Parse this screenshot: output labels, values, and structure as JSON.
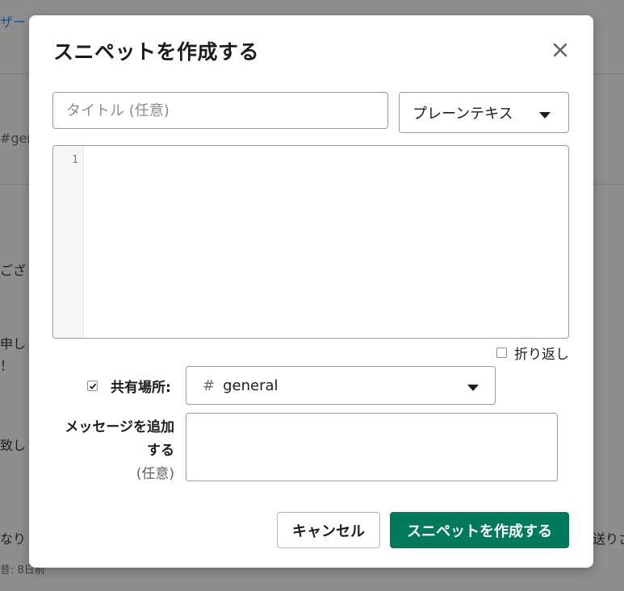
{
  "background": {
    "fragments": [
      {
        "text": "ザー",
        "style": "link"
      },
      {
        "text": "#ger",
        "style": "muted"
      },
      {
        "text": "ござ",
        "style": ""
      },
      {
        "text": "申し",
        "style": ""
      },
      {
        "text": "！",
        "style": ""
      },
      {
        "text": "致し",
        "style": ""
      },
      {
        "text": "なり",
        "style": ""
      },
      {
        "text": "送りさ",
        "style": ""
      },
      {
        "text": "昔: 8日前",
        "style": "small"
      }
    ]
  },
  "modal": {
    "title": "スニペットを作成する",
    "close_icon": "close-icon",
    "title_input": {
      "placeholder": "タイトル (任意)",
      "value": ""
    },
    "type_select": {
      "selected": "プレーンテキス"
    },
    "editor": {
      "line_numbers": [
        "1"
      ],
      "content": ""
    },
    "wrap": {
      "label": "折り返し",
      "checked": false
    },
    "share": {
      "label": "共有場所:",
      "checked": true,
      "channel_hash": "#",
      "channel": "general"
    },
    "message": {
      "label_line1": "メッセージを追加",
      "label_line2": "する",
      "label_optional": "(任意)",
      "value": ""
    },
    "buttons": {
      "cancel": "キャンセル",
      "create": "スニペットを作成する"
    },
    "colors": {
      "primary": "#007a5a",
      "overlay": "#8e8e8e"
    }
  }
}
